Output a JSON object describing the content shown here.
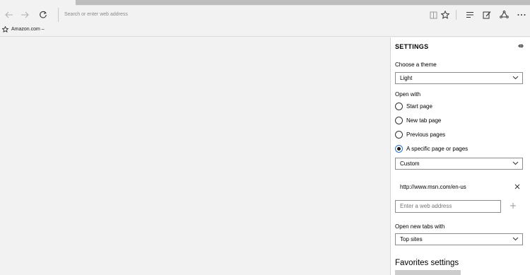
{
  "toolbar": {
    "address_placeholder": "Search or enter web address",
    "back_icon": "arrow-left-icon",
    "forward_icon": "arrow-right-icon",
    "refresh_icon": "refresh-icon",
    "reading_view_icon": "book-icon",
    "favorite_icon": "star-icon",
    "hub_icon": "hub-icon",
    "note_icon": "pen-icon",
    "share_icon": "share-icon",
    "more_icon": "more-icon"
  },
  "favorites_bar": {
    "items": [
      {
        "label": "Amazon.com –"
      }
    ]
  },
  "settings": {
    "title": "SETTINGS",
    "choose_theme_label": "Choose a theme",
    "theme_value": "Light",
    "open_with_label": "Open with",
    "open_with_options": [
      {
        "label": "Start page",
        "checked": false
      },
      {
        "label": "New tab page",
        "checked": false
      },
      {
        "label": "Previous pages",
        "checked": false
      },
      {
        "label": "A specific page or pages",
        "checked": true
      }
    ],
    "specific_page_value": "Custom",
    "custom_url": "http://www.msn.com/en-us",
    "add_address_placeholder": "Enter a web address",
    "open_new_tabs_label": "Open new tabs with",
    "new_tabs_value": "Top sites",
    "favorites_settings_heading": "Favorites settings"
  },
  "colors": {
    "accent": "#2b72c2",
    "chrome_background": "#f2f2f2",
    "pane_background": "#ffffff"
  }
}
